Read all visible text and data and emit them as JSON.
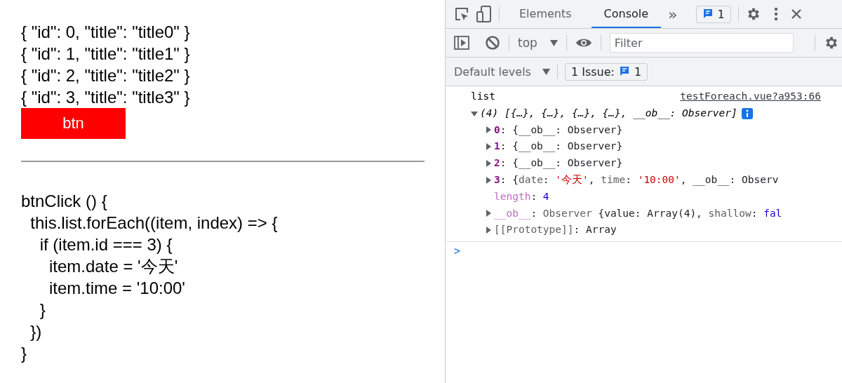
{
  "page": {
    "items": [
      "{ \"id\": 0, \"title\": \"title0\" }",
      "{ \"id\": 1, \"title\": \"title1\" }",
      "{ \"id\": 2, \"title\": \"title2\" }",
      "{ \"id\": 3, \"title\": \"title3\" }"
    ],
    "button": "btn",
    "code": [
      "btnClick () {",
      "  this.list.forEach((item, index) => {",
      "    if (item.id === 3) {",
      "      item.date = '今天'",
      "      item.time = '10:00'",
      "    }",
      "  })",
      "}"
    ]
  },
  "devtools": {
    "tabs": [
      {
        "label": "Elements",
        "selected": false
      },
      {
        "label": "Console",
        "selected": true
      }
    ],
    "more": "»",
    "messages_badge": "1",
    "context": "top",
    "filter": {
      "placeholder": "Filter"
    },
    "levels": "Default levels",
    "issues": {
      "label": "1 Issue:",
      "count": "1"
    },
    "log": {
      "label": "list",
      "source": "testForeach.vue?a953:66",
      "summary": {
        "expanded": true,
        "text": "(4) [{…}, {…}, {…}, {…}, __ob__: Observer]"
      },
      "rows": [
        {
          "kind": "toggle",
          "expanded": false,
          "segments": [
            {
              "kind": "index",
              "text": "0"
            },
            {
              "kind": "plain",
              "text": ": {__ob__: Observer}"
            }
          ]
        },
        {
          "kind": "toggle",
          "expanded": false,
          "segments": [
            {
              "kind": "index",
              "text": "1"
            },
            {
              "kind": "plain",
              "text": ": {__ob__: Observer}"
            }
          ]
        },
        {
          "kind": "toggle",
          "expanded": false,
          "segments": [
            {
              "kind": "index",
              "text": "2"
            },
            {
              "kind": "plain",
              "text": ": {__ob__: Observer}"
            }
          ]
        },
        {
          "kind": "toggle",
          "expanded": false,
          "segments": [
            {
              "kind": "index",
              "text": "3"
            },
            {
              "kind": "plain",
              "text": ": {"
            },
            {
              "kind": "key",
              "text": "date"
            },
            {
              "kind": "plain",
              "text": ": "
            },
            {
              "kind": "string",
              "text": "'今天'"
            },
            {
              "kind": "plain",
              "text": ", "
            },
            {
              "kind": "key",
              "text": "time"
            },
            {
              "kind": "plain",
              "text": ": "
            },
            {
              "kind": "string",
              "text": "'10:00'"
            },
            {
              "kind": "plain",
              "text": ", __ob__: Observ"
            }
          ]
        },
        {
          "kind": "leaf",
          "segments": [
            {
              "kind": "prop",
              "text": "length"
            },
            {
              "kind": "plain",
              "text": ": "
            },
            {
              "kind": "number",
              "text": "4"
            }
          ]
        },
        {
          "kind": "toggle",
          "expanded": false,
          "segments": [
            {
              "kind": "prop",
              "text": "__ob__"
            },
            {
              "kind": "plain",
              "text": ": "
            },
            {
              "kind": "key",
              "text": "Observer"
            },
            {
              "kind": "plain",
              "text": " {value: Array(4), "
            },
            {
              "kind": "key",
              "text": "shallow"
            },
            {
              "kind": "plain",
              "text": ": "
            },
            {
              "kind": "keyword",
              "text": "fal"
            }
          ]
        },
        {
          "kind": "toggle",
          "expanded": false,
          "segments": [
            {
              "kind": "key",
              "text": "[[Prototype]]"
            },
            {
              "kind": "plain",
              "text": ": Array"
            }
          ]
        }
      ],
      "prompt": ">"
    }
  }
}
